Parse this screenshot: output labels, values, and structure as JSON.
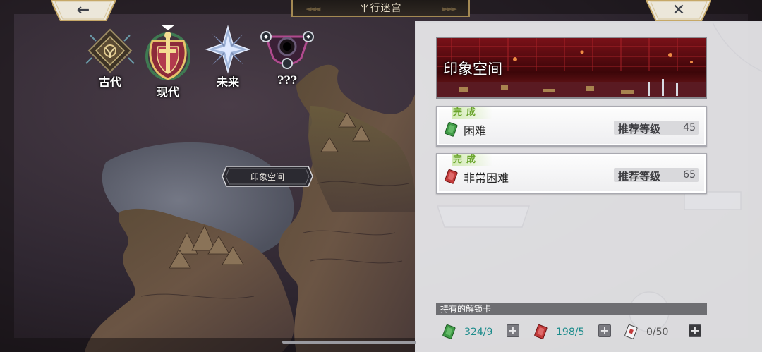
{
  "header": {
    "title": "平行迷宫",
    "back_icon": "←",
    "close_icon": "✕"
  },
  "eras": [
    {
      "label": "古代",
      "icon": "ancient-crest-icon"
    },
    {
      "label": "现代",
      "icon": "modern-crest-icon",
      "selected": true
    },
    {
      "label": "未来",
      "icon": "future-star-icon"
    },
    {
      "label": "???",
      "icon": "unknown-arc-icon"
    }
  ],
  "map": {
    "location_label": "印象空间"
  },
  "panel": {
    "banner_title": "印象空间",
    "difficulties": [
      {
        "status": "完成",
        "name": "困难",
        "recommend_label": "推荐等级",
        "level": "45",
        "color": "#3f9a46"
      },
      {
        "status": "完成",
        "name": "非常困难",
        "recommend_label": "推荐等级",
        "level": "65",
        "color": "#c23a3a"
      }
    ],
    "cards_header": "持有的解锁卡",
    "cards": {
      "green_count": "324/9",
      "red_count": "198/5",
      "special_count": "0/50",
      "plus": "+"
    }
  },
  "colors": {
    "accent_gold": "#a38953",
    "done_green": "#6aa52c",
    "count_teal": "#1e8c8c"
  }
}
